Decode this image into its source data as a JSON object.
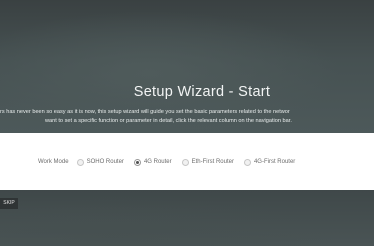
{
  "header": {
    "title": "Setup Wizard - Start",
    "description_line1": "rs has never been so easy as it is now, this setup wizard will guide you set the basic parameters related to the networ",
    "description_line2": "want to set a specific function or parameter in detail, click the relevant column on the navigation bar."
  },
  "work_mode": {
    "label": "Work Mode",
    "options": [
      {
        "label": "SOHO Router",
        "checked": false
      },
      {
        "label": "4G Router",
        "checked": true
      },
      {
        "label": "Eth-First Router",
        "checked": false
      },
      {
        "label": "4G-First Router",
        "checked": false
      }
    ]
  },
  "footer": {
    "skip_label": "SKIP"
  }
}
